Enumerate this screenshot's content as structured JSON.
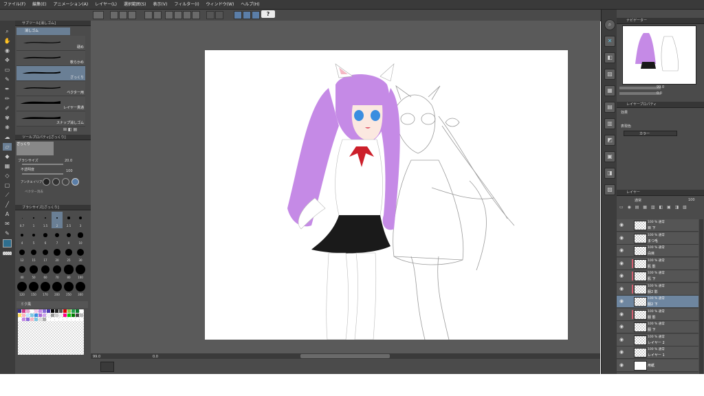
{
  "menu": [
    "ファイル(F)",
    "編集(E)",
    "アニメーション(A)",
    "レイヤー(L)",
    "選択範囲(S)",
    "表示(V)",
    "フィルター(I)",
    "ウィンドウ(W)",
    "ヘルプ(H)"
  ],
  "help_label": "?",
  "subtool_panel": {
    "header": "サブツール[消しゴム]",
    "tab": "消しゴム",
    "brushes": [
      {
        "label": "硬め"
      },
      {
        "label": "軟らかめ"
      },
      {
        "label": "ざっくり"
      },
      {
        "label": "ベクター用"
      },
      {
        "label": "レイヤー貫通"
      },
      {
        "label": "スナップ消しゴム"
      }
    ]
  },
  "tool_property": {
    "header": "ツールプロパティ[ざっくり]",
    "preset": "ざっくり",
    "brush_size_label": "ブラシサイズ",
    "brush_size_value": "20.0",
    "opacity_label": "不透明度",
    "opacity_value": "100",
    "antialias_label": "アンチエイリアス",
    "vector_erase_label": "ベクター消去"
  },
  "brush_size_panel": {
    "header": "ブラシサイズ[ざっくり]",
    "sizes": [
      "0.7",
      "1",
      "1.5",
      "2",
      "2.5",
      "3",
      "4",
      "5",
      "6",
      "7",
      "8",
      "10",
      "12",
      "15",
      "17",
      "20",
      "25",
      "30",
      "40",
      "50",
      "60",
      "70",
      "80",
      "100",
      "120",
      "150",
      "170",
      "200",
      "250",
      "300"
    ],
    "selected": "2"
  },
  "color_set_panel": {
    "label": "ミク風"
  },
  "navigator": {
    "header": "ナビゲーター",
    "zoom": "99.0",
    "rotation": "0.0"
  },
  "layer_property": {
    "header": "レイヤープロパティ",
    "effect_label": "効果",
    "expression_label": "表現色",
    "expression_value": "カラー"
  },
  "layer_panel": {
    "header": "レイヤー",
    "blend_mode": "通常",
    "opacity": "100",
    "layers": [
      {
        "mode": "100 % 通常",
        "name": "目 下",
        "marked": false,
        "selected": false
      },
      {
        "mode": "100 % 通常",
        "name": "まつ毛",
        "marked": false,
        "selected": false
      },
      {
        "mode": "100 % 通常",
        "name": "白目",
        "marked": false,
        "selected": false
      },
      {
        "mode": "100 % 通常",
        "name": "肌 影",
        "marked": true,
        "selected": false
      },
      {
        "mode": "100 % 通常",
        "name": "肌 下",
        "marked": true,
        "selected": false
      },
      {
        "mode": "100 % 通常",
        "name": "服2 影",
        "marked": true,
        "selected": false
      },
      {
        "mode": "100 % 通常",
        "name": "服2 下",
        "marked": false,
        "selected": true
      },
      {
        "mode": "100 % 通常",
        "name": "服 影",
        "marked": true,
        "selected": false
      },
      {
        "mode": "100 % 通常",
        "name": "服 下",
        "marked": false,
        "selected": false
      },
      {
        "mode": "100 % 通常",
        "name": "レイヤー 2",
        "marked": false,
        "selected": false
      },
      {
        "mode": "100 % 通常",
        "name": "レイヤー 1",
        "marked": false,
        "selected": false
      },
      {
        "mode": "",
        "name": "用紙",
        "marked": false,
        "selected": false
      }
    ]
  },
  "status": {
    "zoom": "99.0",
    "rotation": "0.0"
  },
  "colors": {
    "hair": "#c58ae6",
    "skirt": "#1a1a1a",
    "ribbon": "#cc1f2a",
    "eyes": "#3a8de0",
    "selected_row": "#6e86a0",
    "panel": "#4b4b4b",
    "canvas_bg": "#5a5a5a"
  }
}
